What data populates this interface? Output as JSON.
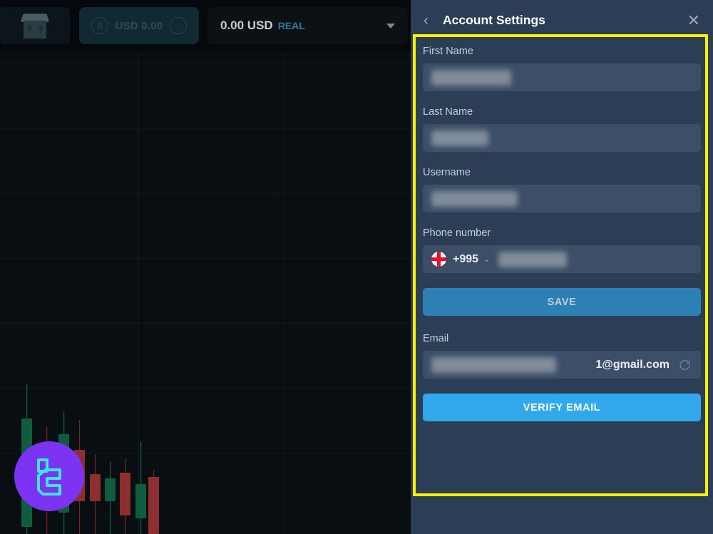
{
  "workspace": {
    "topbar": {
      "mystery_box": {
        "icon": "mystery-cube-icon",
        "marks": "? ?"
      },
      "wallet": {
        "left_icon": "coin-icon",
        "amount": "USD 0.00",
        "right_icon": "gift-icon"
      },
      "balance": {
        "amount": "0.00 USD",
        "account_type": "REAL",
        "caret_icon": "caret-down-icon"
      }
    },
    "brand": {
      "logo_icon": "brand-logo-icon",
      "monogram": "LC"
    }
  },
  "panel": {
    "back_icon": "chevron-left-icon",
    "title": "Account Settings",
    "close_icon": "close-icon",
    "fields": {
      "first_name": {
        "label": "First Name",
        "value": "",
        "redacted": true
      },
      "last_name": {
        "label": "Last Name",
        "value": "",
        "redacted": true
      },
      "username": {
        "label": "Username",
        "value": "",
        "redacted": true
      },
      "phone": {
        "label": "Phone number",
        "country_flag": "georgia-flag-icon",
        "dial_code": "+995",
        "caret_icon": "chevron-down-icon",
        "value": "",
        "redacted": true
      },
      "email": {
        "label": "Email",
        "value": "1@gmail.com",
        "redacted_prefix": true,
        "resend_icon": "refresh-icon"
      }
    },
    "buttons": {
      "save": "SAVE",
      "verify_email": "VERIFY EMAIL"
    }
  },
  "colors": {
    "panel_bg": "#2c3e55",
    "input_bg": "#3c4f67",
    "save_blue": "#2e7fb4",
    "verify_blue": "#32a8ec",
    "highlight_yellow": "#fff200",
    "accent_real": "#2f7e95",
    "logo_purple": "#7c33f2",
    "logo_cyan": "#39e7f5"
  }
}
